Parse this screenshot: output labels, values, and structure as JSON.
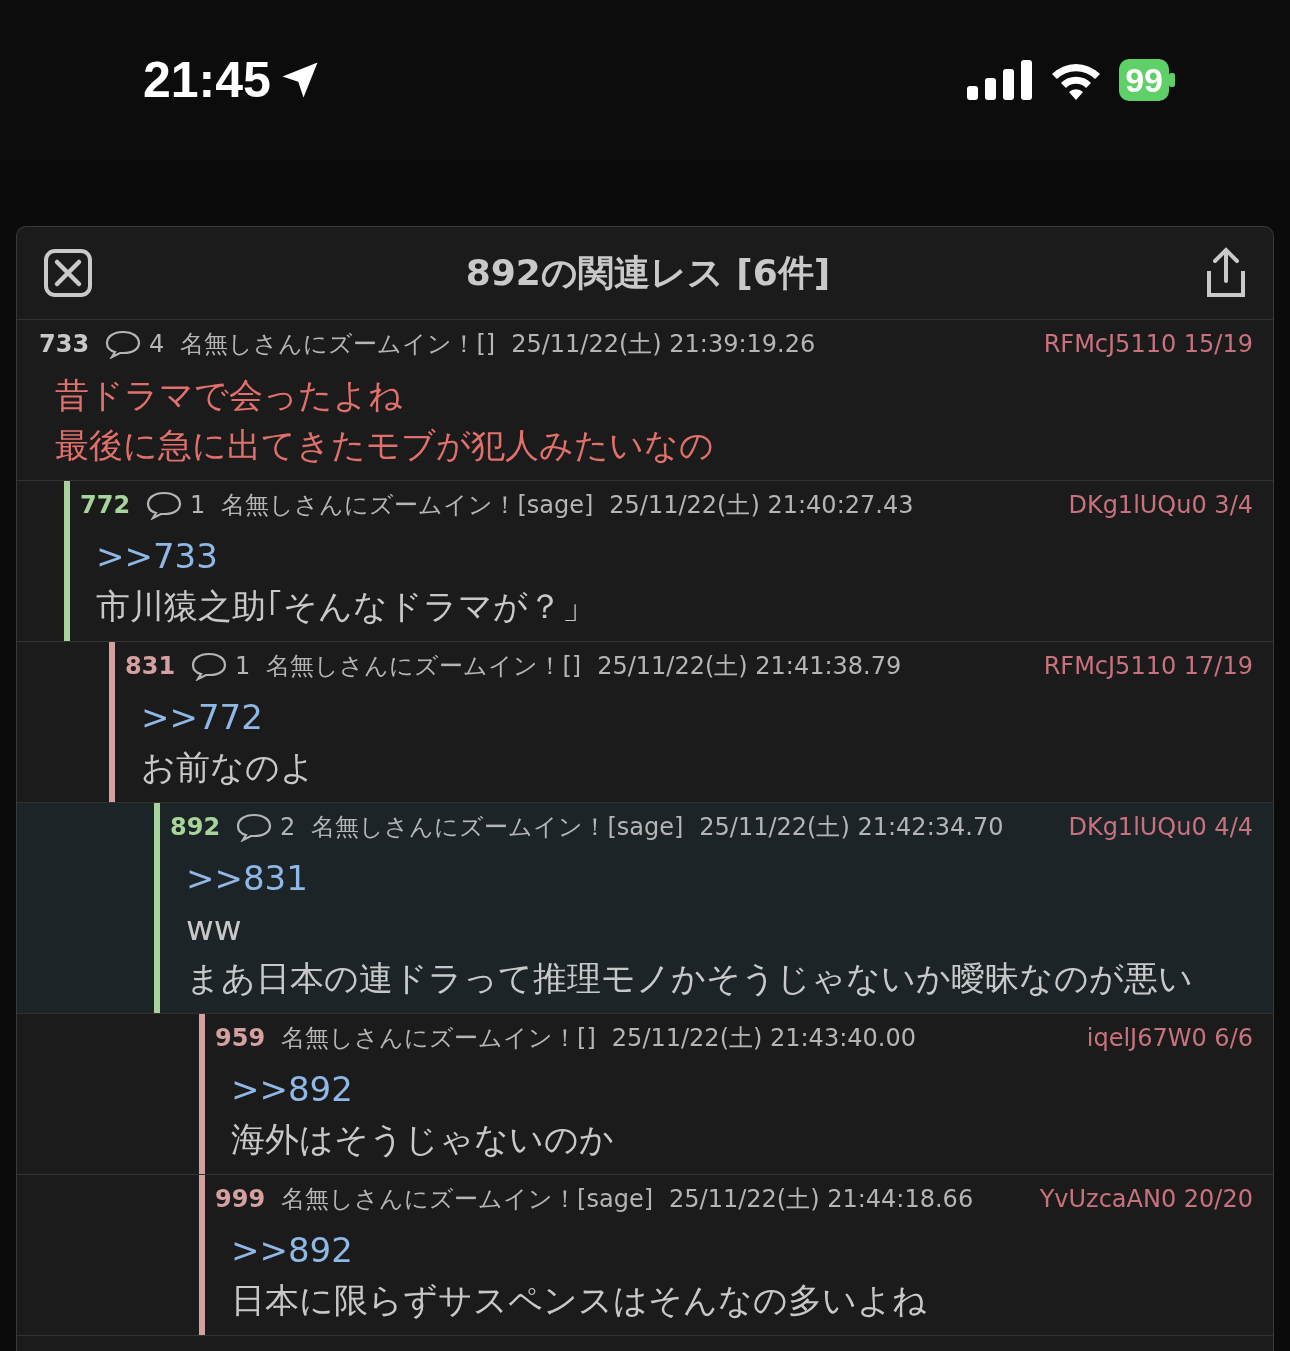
{
  "status_bar": {
    "time": "21:45",
    "battery": "99"
  },
  "dialog": {
    "title": "892の関連レス [6件]",
    "posts": [
      {
        "number": "733",
        "replies": "4",
        "name": "名無しさんにズームイン！[]",
        "date": "25/11/22(土) 21:39:19.26",
        "id": "RFMcJ5110 15/19",
        "selected": false,
        "lines": [
          {
            "kind": "highlight",
            "text": "昔ドラマで会ったよね"
          },
          {
            "kind": "highlight",
            "text": "最後に急に出てきたモブが犯人みたいなの"
          }
        ],
        "children": [
          {
            "number": "772",
            "replies": "1",
            "name": "名無しさんにズームイン！[sage]",
            "date": "25/11/22(土) 21:40:27.43",
            "id": "DKg1lUQu0 3/4",
            "color": "#a6d49a",
            "selected": false,
            "lines": [
              {
                "kind": "anchor",
                "text": ">>733"
              },
              {
                "kind": "text",
                "text": "市川猿之助｢そんなドラマが？」"
              }
            ],
            "children": [
              {
                "number": "831",
                "replies": "1",
                "name": "名無しさんにズームイン！[]",
                "date": "25/11/22(土) 21:41:38.79",
                "id": "RFMcJ5110 17/19",
                "color": "#d4a0a0",
                "selected": false,
                "lines": [
                  {
                    "kind": "anchor",
                    "text": ">>772"
                  },
                  {
                    "kind": "text",
                    "text": "お前なのよ"
                  }
                ],
                "children": [
                  {
                    "number": "892",
                    "replies": "2",
                    "name": "名無しさんにズームイン！[sage]",
                    "date": "25/11/22(土) 21:42:34.70",
                    "id": "DKg1lUQu0 4/4",
                    "color": "#a6d49a",
                    "selected": true,
                    "lines": [
                      {
                        "kind": "anchor",
                        "text": ">>831"
                      },
                      {
                        "kind": "text",
                        "text": "ww"
                      },
                      {
                        "kind": "text",
                        "text": "まあ日本の連ドラって推理モノかそうじゃないか曖昧なのが悪い"
                      }
                    ],
                    "children": [
                      {
                        "number": "959",
                        "name": "名無しさんにズームイン！[]",
                        "date": "25/11/22(土) 21:43:40.00",
                        "id": "iqelJ67W0 6/6",
                        "color": "#d4a0a0",
                        "selected": false,
                        "lines": [
                          {
                            "kind": "anchor",
                            "text": ">>892"
                          },
                          {
                            "kind": "text",
                            "text": "海外はそうじゃないのか"
                          }
                        ]
                      },
                      {
                        "number": "999",
                        "name": "名無しさんにズームイン！[sage]",
                        "date": "25/11/22(土) 21:44:18.66",
                        "id": "YvUzcaAN0 20/20",
                        "color": "#d4a0a0",
                        "selected": false,
                        "lines": [
                          {
                            "kind": "anchor",
                            "text": ">>892"
                          },
                          {
                            "kind": "text",
                            "text": "日本に限らずサスペンスはそんなの多いよね"
                          }
                        ]
                      }
                    ]
                  }
                ]
              }
            ]
          }
        ]
      }
    ]
  }
}
